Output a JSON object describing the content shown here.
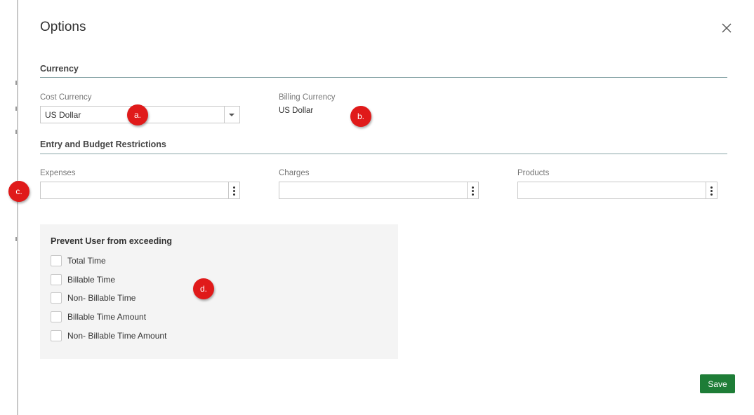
{
  "dialog": {
    "title": "Options",
    "close_icon": "close-icon"
  },
  "currency": {
    "section_title": "Currency",
    "cost_currency": {
      "label": "Cost Currency",
      "value": "US Dollar"
    },
    "billing_currency": {
      "label": "Billing Currency",
      "value": "US Dollar"
    }
  },
  "restrictions": {
    "section_title": "Entry and Budget Restrictions",
    "expenses": {
      "label": "Expenses",
      "value": ""
    },
    "charges": {
      "label": "Charges",
      "value": ""
    },
    "products": {
      "label": "Products",
      "value": ""
    }
  },
  "prevent": {
    "title": "Prevent User from exceeding",
    "options": [
      {
        "label": "Total Time",
        "checked": false
      },
      {
        "label": "Billable Time",
        "checked": false
      },
      {
        "label": "Non- Billable Time",
        "checked": false
      },
      {
        "label": "Billable Time Amount",
        "checked": false
      },
      {
        "label": "Non- Billable Time Amount",
        "checked": false
      }
    ]
  },
  "footer": {
    "save_label": "Save"
  },
  "callouts": [
    "a.",
    "b.",
    "c.",
    "d."
  ],
  "colors": {
    "callout": "#e01a1a",
    "save_button": "#1e7d37",
    "section_rule": "#8aa6a8",
    "panel_background": "#f4f4f4"
  }
}
